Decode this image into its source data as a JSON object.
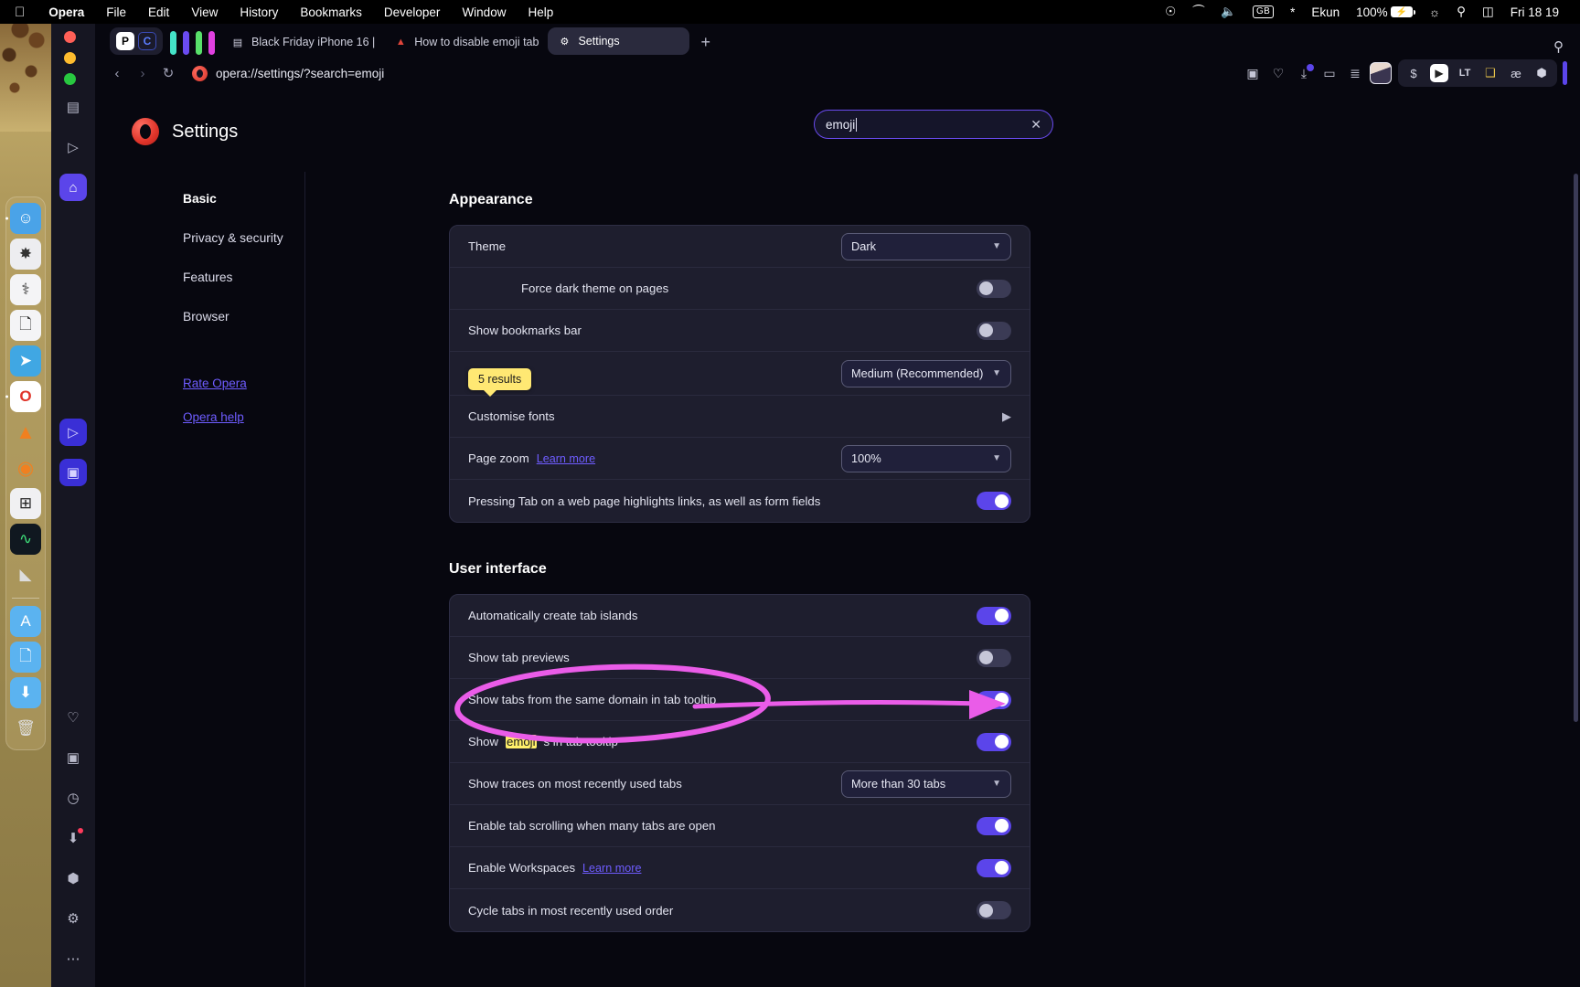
{
  "menubar": {
    "apple_icon": "apple-icon",
    "app": "Opera",
    "items": [
      "File",
      "Edit",
      "View",
      "History",
      "Bookmarks",
      "Developer",
      "Window",
      "Help"
    ],
    "status": {
      "grammarly_icon": "grammarly-icon",
      "eject_icon": "eject-icon",
      "volume_icon": "volume-icon",
      "keyboard_layout": "GB",
      "bluetooth_icon": "bluetooth-icon",
      "user": "Ekun",
      "battery_percent": "100%",
      "battery_icon": "battery-charging-icon",
      "wifi_icon": "wifi-icon",
      "search_icon": "spotlight-search-icon",
      "control_center_icon": "control-center-icon",
      "datetime": "Fri 18 19"
    }
  },
  "dock": {
    "items": [
      {
        "name": "finder",
        "glyph": "☺",
        "bg": "#4aa3e8",
        "running": true
      },
      {
        "name": "safari-alt",
        "glyph": "✸",
        "bg": "#e8e8ea",
        "running": false
      },
      {
        "name": "stethoscope-app",
        "glyph": "⚕",
        "bg": "#f2f2f4",
        "running": false
      },
      {
        "name": "documents-app",
        "glyph": "🗎",
        "bg": "#f4f4f6",
        "running": false
      },
      {
        "name": "telegram",
        "glyph": "➤",
        "bg": "#40a7e3",
        "running": false
      },
      {
        "name": "opera",
        "glyph": "O",
        "bg": "#ffffff",
        "running": true
      },
      {
        "name": "vlc",
        "glyph": "▲",
        "bg": "#00000000",
        "running": false
      },
      {
        "name": "eye-app",
        "glyph": "◉",
        "bg": "#00000000",
        "running": false
      },
      {
        "name": "calculator",
        "glyph": "⊞",
        "bg": "#f0f0f2",
        "running": false
      },
      {
        "name": "activity-monitor",
        "glyph": "∿",
        "bg": "#101820",
        "running": false
      },
      {
        "name": "scanner-app",
        "glyph": "◣",
        "bg": "#00000000",
        "running": false
      }
    ],
    "folders": [
      {
        "name": "applications-folder",
        "glyph": "A",
        "bg": "#5bb3f0"
      },
      {
        "name": "documents-folder",
        "glyph": "🗎",
        "bg": "#5bb3f0"
      },
      {
        "name": "downloads-folder",
        "glyph": "⬇",
        "bg": "#5bb3f0"
      },
      {
        "name": "trash",
        "glyph": "🗑",
        "bg": "#00000000"
      }
    ]
  },
  "browser": {
    "traffic_lights": [
      "close",
      "minimize",
      "zoom"
    ],
    "rail": [
      {
        "name": "sidebar-panel-bookmarks",
        "glyph": "▤",
        "accent": false
      },
      {
        "name": "sidebar-panel-player",
        "glyph": "▷",
        "accent": false
      },
      {
        "name": "sidebar-panel-home",
        "glyph": "⌂",
        "accent": true
      },
      {
        "name": "sidebar-panel-favorites",
        "glyph": "♡",
        "accent": false
      },
      {
        "name": "sidebar-panel-messenger",
        "glyph": "▣",
        "accent": false
      },
      {
        "name": "sidebar-panel-history",
        "glyph": "◷",
        "accent": false
      },
      {
        "name": "sidebar-panel-downloads",
        "glyph": "⬇",
        "accent": false
      },
      {
        "name": "sidebar-panel-extensions",
        "glyph": "⬡",
        "accent": false
      },
      {
        "name": "sidebar-panel-settings",
        "glyph": "⚙",
        "accent": false
      },
      {
        "name": "sidebar-panel-more",
        "glyph": "⋯",
        "accent": false
      }
    ],
    "rail_mid": [
      {
        "name": "sidebar-panel-aria",
        "glyph": "▷"
      },
      {
        "name": "sidebar-panel-flow",
        "glyph": "▣"
      }
    ],
    "tabgroup_icons": [
      {
        "name": "workspace-icon-p",
        "label": "P"
      },
      {
        "name": "workspace-icon-c",
        "label": "C"
      }
    ],
    "tab_islands": [
      "#44e3c8",
      "#6a4bf0",
      "#58e06a",
      "#e040e0"
    ],
    "tabs": [
      {
        "name": "tab-black-friday",
        "favicon": "news-favicon",
        "label": "Black Friday iPhone 16 |",
        "active": false
      },
      {
        "name": "tab-how-to-disable-emoji",
        "favicon": "site-favicon",
        "label": "How to disable emoji tab",
        "active": false
      },
      {
        "name": "tab-settings",
        "favicon": "gear-icon",
        "label": "Settings",
        "active": true
      }
    ],
    "new_tab_label": "+",
    "tabbar_search_icon": "search-icon",
    "address": {
      "back_icon": "chevron-left-icon",
      "forward_icon": "chevron-right-icon",
      "reload_icon": "reload-icon",
      "site_icon": "opera-logo-icon",
      "url": "opera://settings/?search=emoji"
    },
    "toolbar_icons": [
      {
        "name": "snapshot-icon",
        "glyph": "▣"
      },
      {
        "name": "heart-icon",
        "glyph": "♡"
      },
      {
        "name": "downloads-icon",
        "glyph": "⤓",
        "badge": true
      },
      {
        "name": "battery-saver-icon",
        "glyph": "▭"
      },
      {
        "name": "easy-setup-icon",
        "glyph": "≡"
      },
      {
        "name": "profile-avatar",
        "glyph": ""
      }
    ],
    "extensions": [
      {
        "name": "extension-dollar-icon",
        "glyph": "$"
      },
      {
        "name": "extension-badge-icon",
        "glyph": "◆"
      },
      {
        "name": "extension-languagetool-icon",
        "glyph": "LT"
      },
      {
        "name": "extension-copy-icon",
        "glyph": "❐"
      },
      {
        "name": "extension-ae-icon",
        "glyph": "æ"
      },
      {
        "name": "extension-cube-icon",
        "glyph": "⬡"
      }
    ]
  },
  "settings": {
    "logo_icon": "opera-logo-icon",
    "title": "Settings",
    "search": {
      "value": "emoji",
      "clear_icon": "close-icon"
    },
    "nav": [
      {
        "name": "sidebar-item-basic",
        "label": "Basic",
        "active": true
      },
      {
        "name": "sidebar-item-privacy-security",
        "label": "Privacy & security",
        "active": false
      },
      {
        "name": "sidebar-item-features",
        "label": "Features",
        "active": false
      },
      {
        "name": "sidebar-item-browser",
        "label": "Browser",
        "active": false
      }
    ],
    "nav_links": [
      {
        "name": "link-rate-opera",
        "label": "Rate Opera"
      },
      {
        "name": "link-opera-help",
        "label": "Opera help"
      }
    ],
    "results_tooltip": "5 results",
    "sections": [
      {
        "name": "appearance",
        "title": "Appearance",
        "rows": [
          {
            "name": "row-theme",
            "label": "Theme",
            "control": "select",
            "value": "Dark",
            "indent": false
          },
          {
            "name": "row-force-dark-theme",
            "label": "Force dark theme on pages",
            "control": "toggle",
            "value": "off",
            "indent": true
          },
          {
            "name": "row-show-bookmarks-bar",
            "label": "Show bookmarks bar",
            "control": "toggle",
            "value": "off",
            "indent": false
          },
          {
            "name": "row-font-size",
            "label": "",
            "control": "select",
            "value": "Medium (Recommended)",
            "indent": false
          },
          {
            "name": "row-customise-fonts",
            "label": "Customise fonts",
            "control": "chevron",
            "value": "",
            "indent": false
          },
          {
            "name": "row-page-zoom",
            "label": "Page zoom",
            "link": "Learn more",
            "control": "select",
            "value": "100%",
            "indent": false
          },
          {
            "name": "row-tab-highlights-links",
            "label": "Pressing Tab on a web page highlights links, as well as form fields",
            "control": "toggle",
            "value": "on",
            "indent": false
          }
        ]
      },
      {
        "name": "user-interface",
        "title": "User interface",
        "rows": [
          {
            "name": "row-auto-tab-islands",
            "label": "Automatically create tab islands",
            "control": "toggle",
            "value": "on",
            "indent": false
          },
          {
            "name": "row-show-tab-previews",
            "label": "Show tab previews",
            "control": "toggle",
            "value": "off",
            "indent": false
          },
          {
            "name": "row-show-tabs-same-domain",
            "label": "Show tabs from the same domain in tab tooltip",
            "control": "toggle",
            "value": "on",
            "indent": false
          },
          {
            "name": "row-show-emojis-tooltip",
            "label_pre": "Show ",
            "label_hl": "emoji",
            "label_post": "s in tab tooltip",
            "control": "toggle",
            "value": "on",
            "indent": false,
            "highlighted": true
          },
          {
            "name": "row-show-traces",
            "label": "Show traces on most recently used tabs",
            "control": "select",
            "value": "More than 30 tabs",
            "indent": false
          },
          {
            "name": "row-tab-scrolling",
            "label": "Enable tab scrolling when many tabs are open",
            "control": "toggle",
            "value": "on",
            "indent": false
          },
          {
            "name": "row-enable-workspaces",
            "label": "Enable Workspaces",
            "link": "Learn more",
            "control": "toggle",
            "value": "on",
            "indent": false
          },
          {
            "name": "row-cycle-tabs",
            "label": "Cycle tabs in most recently used order",
            "control": "toggle",
            "value": "off",
            "indent": false
          }
        ]
      }
    ]
  },
  "annotation": {
    "color": "#ea5ce8",
    "ellipse_name": "annotation-ellipse-emoji-row",
    "arrow_name": "annotation-arrow-to-toggle"
  }
}
